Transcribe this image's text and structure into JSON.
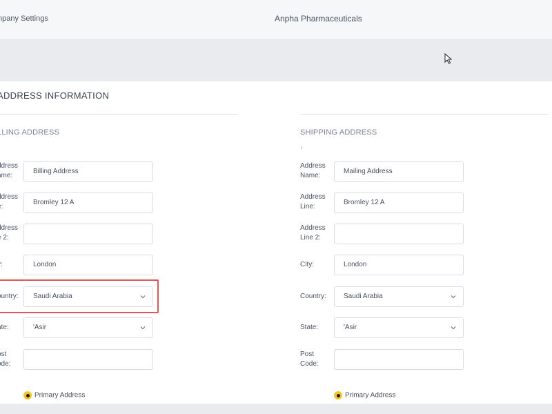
{
  "topbar": {
    "breadcrumb": "mpany Settings",
    "company_name": "Anpha Pharmaceuticals"
  },
  "section": {
    "title": "ADDRESS INFORMATION"
  },
  "billing": {
    "heading": "LLING ADDRESS",
    "labels": {
      "name": "ddress\name:",
      "line": "ddress\ne:",
      "line2": "ddress\ne 2:",
      "city": "y:",
      "country": "ountry:",
      "state": "ate:",
      "post": "ost\node:"
    },
    "values": {
      "name": "Billing Address",
      "line": "Bromley 12 A",
      "line2": "",
      "city": "London",
      "country": "Saudi Arabia",
      "state": "'Asir",
      "post": ""
    },
    "primary_label": "Primary Address"
  },
  "shipping": {
    "heading": "SHIPPING ADDRESS",
    "labels": {
      "name": "Address\nName:",
      "line": "Address\nLine:",
      "line2": "Address\nLine 2:",
      "city": "City:",
      "country": "Country:",
      "state": "State:",
      "post": "Post\nCode:"
    },
    "values": {
      "name": "Mailing Address",
      "line": "Bromley 12 A",
      "line2": "",
      "city": "London",
      "country": "Saudi Arabia",
      "state": "'Asir",
      "post": ""
    },
    "primary_label": "Primary Address"
  },
  "colors": {
    "accent_radio": "#f3c623",
    "highlight_border": "#e05656"
  }
}
